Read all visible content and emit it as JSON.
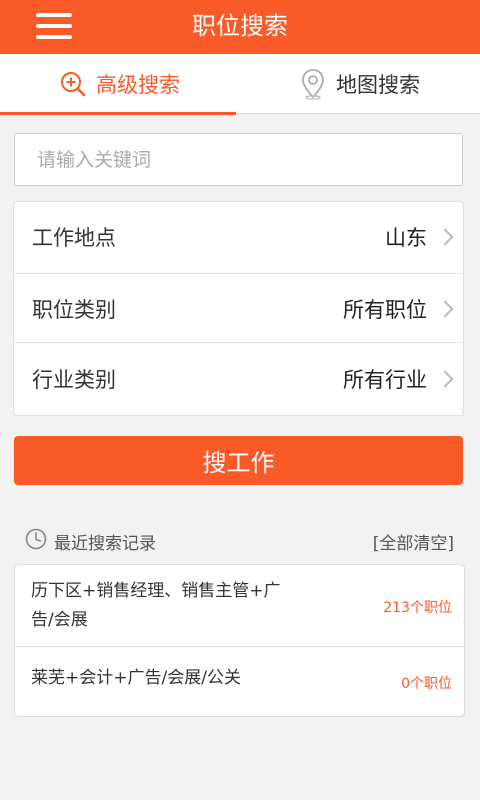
{
  "header": {
    "title": "职位搜索"
  },
  "tabs": [
    {
      "label": "高级搜索",
      "active": true,
      "icon": "search-plus-icon"
    },
    {
      "label": "地图搜索",
      "active": false,
      "icon": "map-pin-icon"
    }
  ],
  "search": {
    "placeholder": "请输入关键词",
    "value": ""
  },
  "filters": [
    {
      "label": "工作地点",
      "value": "山东"
    },
    {
      "label": "职位类别",
      "value": "所有职位"
    },
    {
      "label": "行业类别",
      "value": "所有行业"
    }
  ],
  "search_button": {
    "label": "搜工作"
  },
  "history": {
    "title": "最近搜索记录",
    "clear_label": "[全部清空]",
    "items": [
      {
        "query": "历下区+销售经理、销售主管+广告/会展",
        "count": "213个职位"
      },
      {
        "query": "莱芜+会计+广告/会展/公关",
        "count": "0个职位"
      }
    ]
  },
  "colors": {
    "accent": "#fa5a28",
    "background": "#f2f2f2"
  }
}
